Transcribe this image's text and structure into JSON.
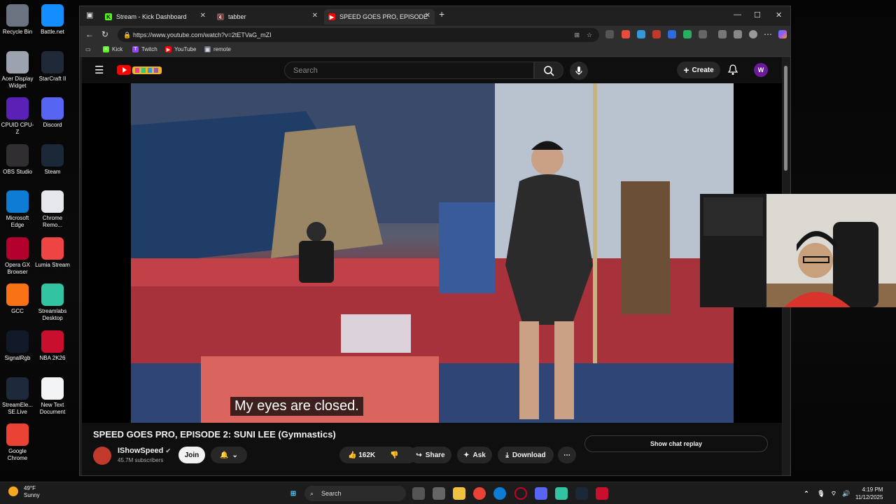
{
  "desktop": {
    "icons": [
      {
        "label": "Recycle Bin",
        "color": "#6b7280"
      },
      {
        "label": "Battle.net",
        "color": "#148eff"
      },
      {
        "label": "Acer Display Widget",
        "color": "#9ca3af"
      },
      {
        "label": "StarCraft II",
        "color": "#1f2937"
      },
      {
        "label": "CPUID CPU-Z",
        "color": "#5b21b6"
      },
      {
        "label": "Discord",
        "color": "#5865f2"
      },
      {
        "label": "OBS Studio",
        "color": "#302e31"
      },
      {
        "label": "Steam",
        "color": "#1b2838"
      },
      {
        "label": "Microsoft Edge",
        "color": "#0c7cd5"
      },
      {
        "label": "Chrome Remo...",
        "color": "#e5e7eb"
      },
      {
        "label": "Opera GX Browser",
        "color": "#b3002d"
      },
      {
        "label": "Lumia Stream",
        "color": "#ef4444"
      },
      {
        "label": "GCC",
        "color": "#f97316"
      },
      {
        "label": "Streamlabs Desktop",
        "color": "#31c3a2"
      },
      {
        "label": "SignalRgb",
        "color": "#111827"
      },
      {
        "label": "NBA 2K26",
        "color": "#c8102e"
      },
      {
        "label": "StreamEle... SE.Live",
        "color": "#1e293b"
      },
      {
        "label": "New Text Document",
        "color": "#f3f4f6"
      },
      {
        "label": "Google Chrome",
        "color": "#ea4335"
      }
    ]
  },
  "browser": {
    "tabs": [
      {
        "title": "Stream - Kick Dashboard",
        "icon": "K"
      },
      {
        "title": "tabber",
        "icon": "▣"
      },
      {
        "title": "SPEED GOES PRO, EPISODE",
        "icon": "▶"
      }
    ],
    "url": "https://www.youtube.com/watch?v=2tETVaG_mZI",
    "favorites": [
      {
        "label": "Kick",
        "icon": "K",
        "color": "#53fc18"
      },
      {
        "label": "Twitch",
        "icon": "T",
        "color": "#9146ff"
      },
      {
        "label": "YouTube",
        "icon": "▶",
        "color": "#ff0000"
      },
      {
        "label": "remote",
        "icon": "▣",
        "color": "#6b7280"
      }
    ]
  },
  "youtube": {
    "search_placeholder": "Search",
    "create_label": "Create",
    "avatar_letter": "W",
    "caption": "My eyes are closed.",
    "video_title": "SPEED GOES PRO, EPISODE 2: SUNI LEE (Gymnastics)",
    "channel_name": "IShowSpeed",
    "subscribers": "45.7M subscribers",
    "join_label": "Join",
    "likes": "162K",
    "share_label": "Share",
    "ask_label": "Ask",
    "download_label": "Download",
    "chat_replay_label": "Show chat replay"
  },
  "taskbar": {
    "weather_temp": "49°F",
    "weather_desc": "Sunny",
    "search_label": "Search",
    "time": "4:19 PM",
    "date": "11/12/2025"
  }
}
